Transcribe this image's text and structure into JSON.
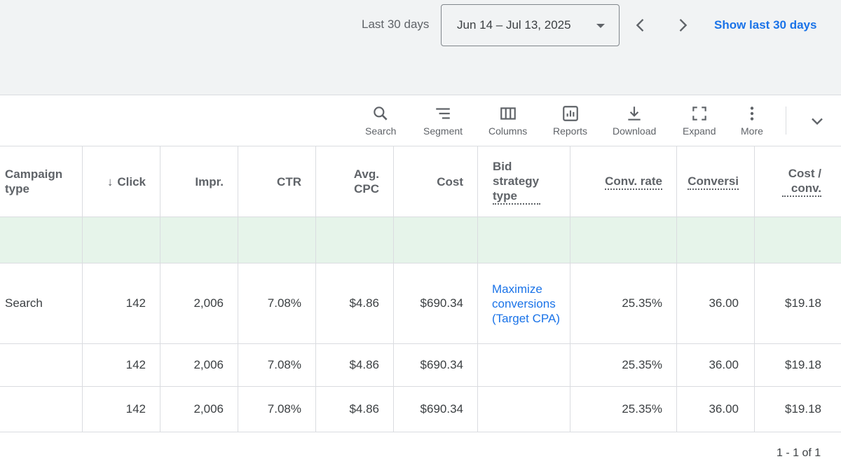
{
  "date_bar": {
    "range_label": "Last 30 days",
    "date_range": "Jun 14 – Jul 13, 2025",
    "show_last_label": "Show last 30 days"
  },
  "toolbar": {
    "search_label": "Search",
    "segment_label": "Segment",
    "columns_label": "Columns",
    "reports_label": "Reports",
    "download_label": "Download",
    "expand_label": "Expand",
    "more_label": "More"
  },
  "table": {
    "headers": {
      "campaign_type": "Campaign type",
      "clicks": "Click",
      "impr": "Impr.",
      "ctr": "CTR",
      "avg_cpc": "Avg. CPC",
      "cost": "Cost",
      "bid_strategy": "Bid strategy type",
      "conv_rate": "Conv. rate",
      "conversions": "Conversi",
      "cost_per_conv": "Cost / conv."
    },
    "rows": [
      {
        "campaign_type": "Search",
        "clicks": "142",
        "impr": "2,006",
        "ctr": "7.08%",
        "avg_cpc": "$4.86",
        "cost": "$690.34",
        "bid_strategy": "Maximize conversions (Target CPA)",
        "conv_rate": "25.35%",
        "conversions": "36.00",
        "cost_per_conv": "$19.18"
      },
      {
        "campaign_type": "",
        "clicks": "142",
        "impr": "2,006",
        "ctr": "7.08%",
        "avg_cpc": "$4.86",
        "cost": "$690.34",
        "bid_strategy": "",
        "conv_rate": "25.35%",
        "conversions": "36.00",
        "cost_per_conv": "$19.18"
      },
      {
        "campaign_type": "",
        "clicks": "142",
        "impr": "2,006",
        "ctr": "7.08%",
        "avg_cpc": "$4.86",
        "cost": "$690.34",
        "bid_strategy": "",
        "conv_rate": "25.35%",
        "conversions": "36.00",
        "cost_per_conv": "$19.18"
      }
    ]
  },
  "pagination": {
    "text": "1 - 1 of 1"
  },
  "colors": {
    "accent": "#1a73e8",
    "highlight_row": "#e6f4ea",
    "header_bg": "#f1f3f4"
  }
}
